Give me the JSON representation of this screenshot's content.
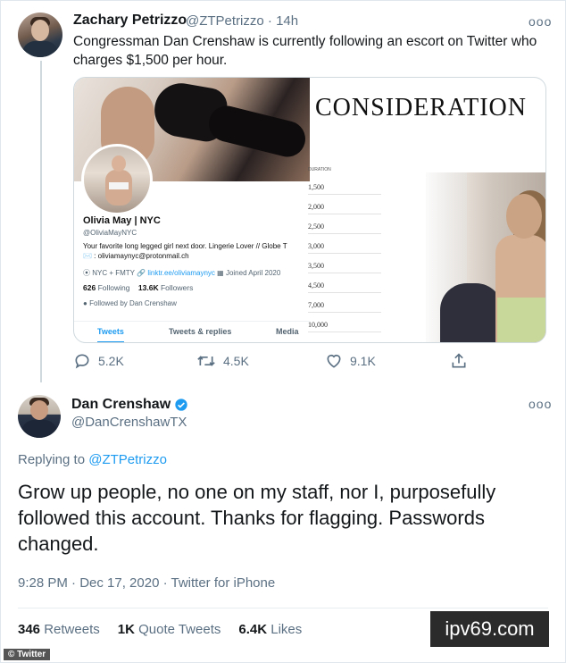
{
  "tweet1": {
    "author_name": "Zachary Petrizzo",
    "author_handle": "@ZTPetrizzo",
    "time": "14h",
    "text": "Congressman Dan Crenshaw is currently following an escort on Twitter who charges $1,500 per hour.",
    "more_label": "ooo",
    "image": {
      "profile": {
        "name": "Olivia May | NYC",
        "handle": "@OliviaMayNYC",
        "bio": "Your favorite long legged girl next door. Lingerie Lover // Globe T",
        "email": "✉️ : oliviamaynyc@protonmail.ch",
        "location": "NYC + FMTY",
        "link": "linktr.ee/oliviamaynyc",
        "joined": "Joined April 2020",
        "following_count": "626",
        "following_label": "Following",
        "followers_count": "13.6K",
        "followers_label": "Followers",
        "followed_by": "Followed by Dan Crenshaw",
        "tabs": [
          "Tweets",
          "Tweets & replies",
          "Media"
        ]
      },
      "heading": "CONSIDERATION",
      "rates_header": "DURATION",
      "rates": [
        "1,500",
        "2,000",
        "2,500",
        "3,000",
        "3,500",
        "4,500",
        "7,000",
        "10,000"
      ]
    },
    "actions": {
      "replies": "5.2K",
      "retweets": "4.5K",
      "likes": "9.1K"
    }
  },
  "tweet2": {
    "author_name": "Dan Crenshaw",
    "author_handle": "@DanCrenshawTX",
    "more_label": "ooo",
    "replying_prefix": "Replying to",
    "replying_to": "@ZTPetrizzo",
    "text": "Grow up people, no one on my staff, nor I, purposefully followed this account. Thanks for flagging. Passwords changed.",
    "meta": "9:28 PM · Dec 17, 2020 · Twitter for iPhone",
    "stats": {
      "retweets_count": "346",
      "retweets_label": "Retweets",
      "quotes_count": "1K",
      "quotes_label": "Quote Tweets",
      "likes_count": "6.4K",
      "likes_label": "Likes"
    }
  },
  "watermark": "ipv69.com",
  "credit": "© Twitter",
  "colors": {
    "accent": "#1d9bf0",
    "muted": "#5b7083",
    "text": "#14171a"
  }
}
